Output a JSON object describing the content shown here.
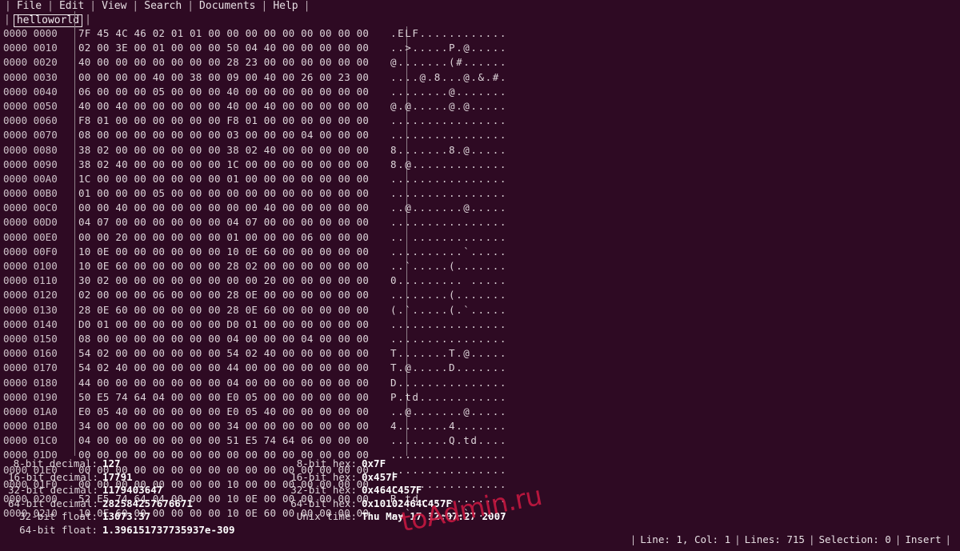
{
  "menu": {
    "separator": "|",
    "items": [
      {
        "label": "File"
      },
      {
        "label": "Edit"
      },
      {
        "label": "View"
      },
      {
        "label": "Search"
      },
      {
        "label": "Documents"
      },
      {
        "label": "Help"
      }
    ]
  },
  "tabs": {
    "separator": "|",
    "items": [
      {
        "label": "helloworld",
        "active": true
      }
    ]
  },
  "hexview": {
    "separator": "|",
    "rows": [
      {
        "address": "0000 0000",
        "bytes": "7F 45 4C 46 02 01 01 00 00 00 00 00 00 00 00 00",
        "ascii": ".ELF............"
      },
      {
        "address": "0000 0010",
        "bytes": "02 00 3E 00 01 00 00 00 50 04 40 00 00 00 00 00",
        "ascii": "..>.....P.@....."
      },
      {
        "address": "0000 0020",
        "bytes": "40 00 00 00 00 00 00 00 28 23 00 00 00 00 00 00",
        "ascii": "@.......(#......"
      },
      {
        "address": "0000 0030",
        "bytes": "00 00 00 00 40 00 38 00 09 00 40 00 26 00 23 00",
        "ascii": "....@.8...@.&.#."
      },
      {
        "address": "0000 0040",
        "bytes": "06 00 00 00 05 00 00 00 40 00 00 00 00 00 00 00",
        "ascii": "........@......."
      },
      {
        "address": "0000 0050",
        "bytes": "40 00 40 00 00 00 00 00 40 00 40 00 00 00 00 00",
        "ascii": "@.@.....@.@....."
      },
      {
        "address": "0000 0060",
        "bytes": "F8 01 00 00 00 00 00 00 F8 01 00 00 00 00 00 00",
        "ascii": "................"
      },
      {
        "address": "0000 0070",
        "bytes": "08 00 00 00 00 00 00 00 03 00 00 00 04 00 00 00",
        "ascii": "................"
      },
      {
        "address": "0000 0080",
        "bytes": "38 02 00 00 00 00 00 00 38 02 40 00 00 00 00 00",
        "ascii": "8.......8.@....."
      },
      {
        "address": "0000 0090",
        "bytes": "38 02 40 00 00 00 00 00 1C 00 00 00 00 00 00 00",
        "ascii": "8.@............."
      },
      {
        "address": "0000 00A0",
        "bytes": "1C 00 00 00 00 00 00 00 01 00 00 00 00 00 00 00",
        "ascii": "................"
      },
      {
        "address": "0000 00B0",
        "bytes": "01 00 00 00 05 00 00 00 00 00 00 00 00 00 00 00",
        "ascii": "................"
      },
      {
        "address": "0000 00C0",
        "bytes": "00 00 40 00 00 00 00 00 00 00 40 00 00 00 00 00",
        "ascii": "..@.......@....."
      },
      {
        "address": "0000 00D0",
        "bytes": "04 07 00 00 00 00 00 00 04 07 00 00 00 00 00 00",
        "ascii": "................"
      },
      {
        "address": "0000 00E0",
        "bytes": "00 00 20 00 00 00 00 00 01 00 00 00 06 00 00 00",
        "ascii": ".. ............."
      },
      {
        "address": "0000 00F0",
        "bytes": "10 0E 00 00 00 00 00 00 10 0E 60 00 00 00 00 00",
        "ascii": "..........`....."
      },
      {
        "address": "0000 0100",
        "bytes": "10 0E 60 00 00 00 00 00 28 02 00 00 00 00 00 00",
        "ascii": "..`.....(......."
      },
      {
        "address": "0000 0110",
        "bytes": "30 02 00 00 00 00 00 00 00 00 20 00 00 00 00 00",
        "ascii": "0......... ....."
      },
      {
        "address": "0000 0120",
        "bytes": "02 00 00 00 06 00 00 00 28 0E 00 00 00 00 00 00",
        "ascii": "........(......."
      },
      {
        "address": "0000 0130",
        "bytes": "28 0E 60 00 00 00 00 00 28 0E 60 00 00 00 00 00",
        "ascii": "(.`.....(.`....."
      },
      {
        "address": "0000 0140",
        "bytes": "D0 01 00 00 00 00 00 00 D0 01 00 00 00 00 00 00",
        "ascii": "................"
      },
      {
        "address": "0000 0150",
        "bytes": "08 00 00 00 00 00 00 00 04 00 00 00 04 00 00 00",
        "ascii": "................"
      },
      {
        "address": "0000 0160",
        "bytes": "54 02 00 00 00 00 00 00 54 02 40 00 00 00 00 00",
        "ascii": "T.......T.@....."
      },
      {
        "address": "0000 0170",
        "bytes": "54 02 40 00 00 00 00 00 44 00 00 00 00 00 00 00",
        "ascii": "T.@.....D......."
      },
      {
        "address": "0000 0180",
        "bytes": "44 00 00 00 00 00 00 00 04 00 00 00 00 00 00 00",
        "ascii": "D..............."
      },
      {
        "address": "0000 0190",
        "bytes": "50 E5 74 64 04 00 00 00 E0 05 00 00 00 00 00 00",
        "ascii": "P.td............"
      },
      {
        "address": "0000 01A0",
        "bytes": "E0 05 40 00 00 00 00 00 E0 05 40 00 00 00 00 00",
        "ascii": "..@.......@....."
      },
      {
        "address": "0000 01B0",
        "bytes": "34 00 00 00 00 00 00 00 34 00 00 00 00 00 00 00",
        "ascii": "4.......4......."
      },
      {
        "address": "0000 01C0",
        "bytes": "04 00 00 00 00 00 00 00 51 E5 74 64 06 00 00 00",
        "ascii": "........Q.td...."
      },
      {
        "address": "0000 01D0",
        "bytes": "00 00 00 00 00 00 00 00 00 00 00 00 00 00 00 00",
        "ascii": "................"
      },
      {
        "address": "0000 01E0",
        "bytes": "00 00 00 00 00 00 00 00 00 00 00 00 00 00 00 00",
        "ascii": "................"
      },
      {
        "address": "0000 01F0",
        "bytes": "00 00 00 00 00 00 00 00 10 00 00 00 00 00 00 00",
        "ascii": "................"
      },
      {
        "address": "0000 0200",
        "bytes": "52 E5 74 64 04 00 00 00 10 0E 00 00 00 00 00 00",
        "ascii": "R.td............"
      },
      {
        "address": "0000 0210",
        "bytes": "10 0E 60 00 00 00 00 00 10 0E 60 00 00 00 00 00",
        "ascii": "..`.......`....."
      }
    ]
  },
  "info": {
    "left": [
      {
        "label": "8-bit decimal:",
        "value": "127"
      },
      {
        "label": "16-bit decimal:",
        "value": "17791"
      },
      {
        "label": "32-bit decimal:",
        "value": "1179403647"
      },
      {
        "label": "64-bit decimal:",
        "value": "282584257676671"
      },
      {
        "label": "32-bit float:",
        "value": "13073.37"
      },
      {
        "label": "64-bit float:",
        "value": "1.396151737735937e-309"
      }
    ],
    "right": [
      {
        "label": "8-bit hex:",
        "value": "0x7F"
      },
      {
        "label": "16-bit hex:",
        "value": "0x457F"
      },
      {
        "label": "32-bit hex:",
        "value": "0x464C457F"
      },
      {
        "label": "64-bit hex:",
        "value": "0x10102464C457F"
      },
      {
        "label": "Unix time:",
        "value": "Thu May 17 12:07:27 2007"
      }
    ]
  },
  "statusbar": {
    "separator": "|",
    "items": [
      {
        "label": "Line: 1, Col: 1"
      },
      {
        "label": "Lines: 715"
      },
      {
        "label": "Selection: 0"
      },
      {
        "label": "Insert"
      }
    ]
  },
  "watermark": {
    "text": "toAdmin.ru",
    "color": "#c21840"
  },
  "colors": {
    "background": "#2e0a23",
    "text": "#ded5da",
    "value": "#ffffff",
    "rule": "#8d7f88"
  }
}
